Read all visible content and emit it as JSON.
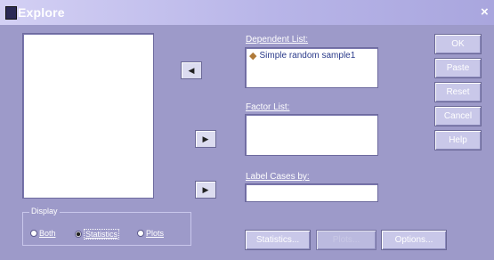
{
  "dialog": {
    "title": "Explore"
  },
  "lists": {
    "dependent_label": "Dependent List:",
    "dependent_items": [
      "Simple random sample1"
    ],
    "factor_label": "Factor List:",
    "label_cases_label": "Label Cases by:"
  },
  "side_buttons": {
    "ok": "OK",
    "paste": "Paste",
    "reset": "Reset",
    "cancel": "Cancel",
    "help": "Help"
  },
  "display": {
    "legend": "Display",
    "options": [
      "Both",
      "Statistics",
      "Plots"
    ],
    "selected": "Statistics"
  },
  "bottom_buttons": {
    "statistics": "Statistics...",
    "plots": "Plots...",
    "options": "Options..."
  },
  "icons": {
    "title": "app-icon",
    "move_left": "arrow-left-icon",
    "move_right": "arrow-right-icon",
    "variable": "scale-variable-icon"
  }
}
